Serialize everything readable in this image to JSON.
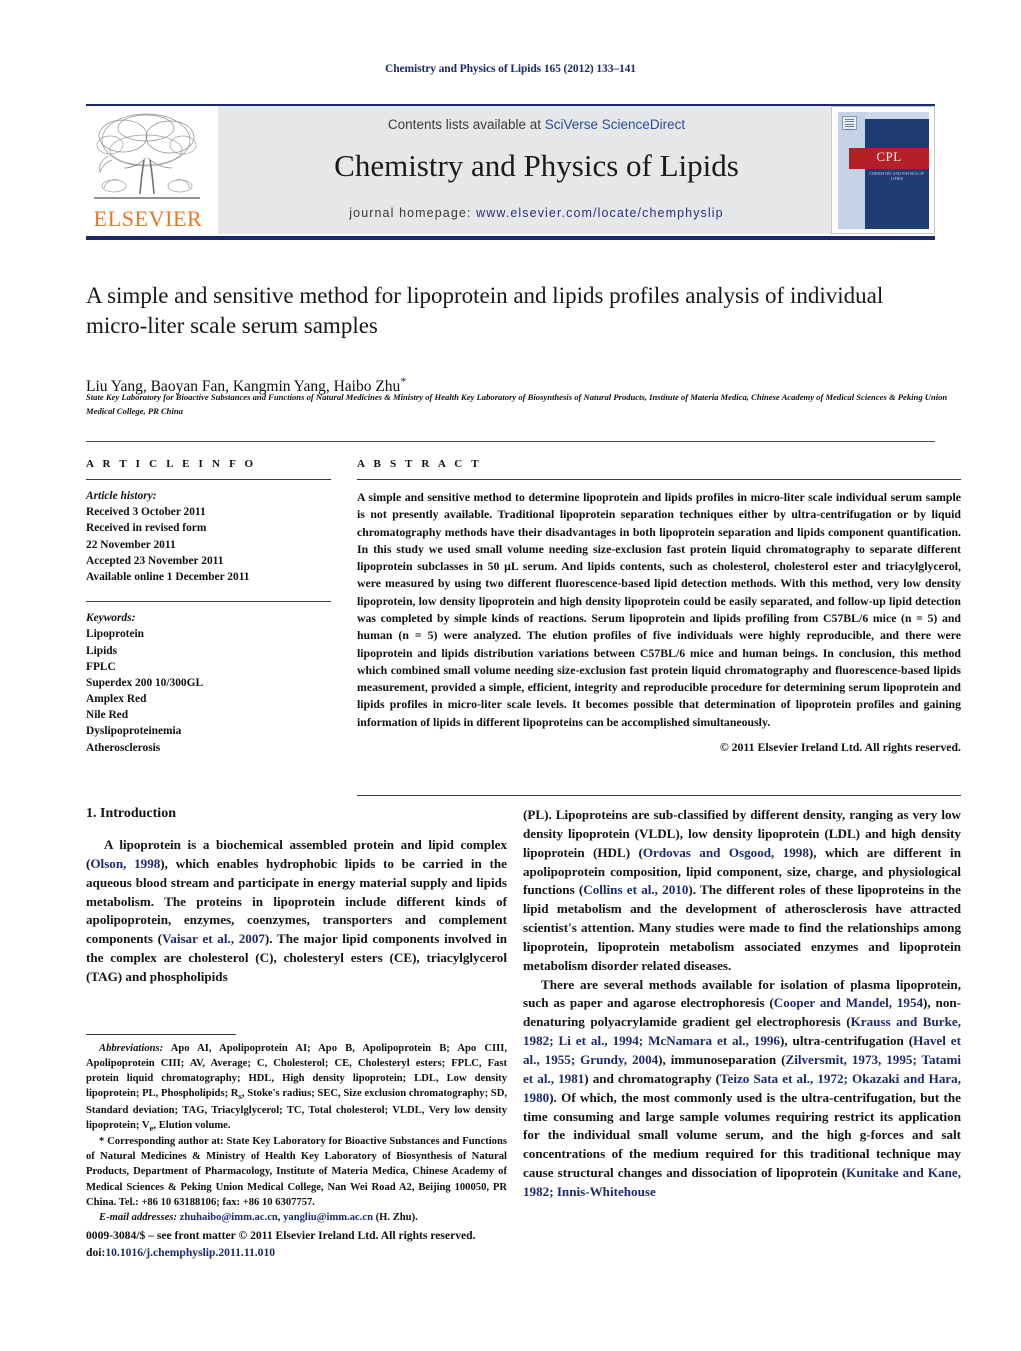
{
  "running_head": "Chemistry and Physics of Lipids 165 (2012) 133–141",
  "journal_header": {
    "contents_prefix": "Contents lists available at ",
    "contents_link": "SciVerse ScienceDirect",
    "journal_title": "Chemistry and Physics of Lipids",
    "homepage_prefix": "journal homepage: ",
    "homepage_url": "www.elsevier.com/locate/chemphyslip",
    "publisher_name": "ELSEVIER",
    "cover": {
      "badge": "CPL",
      "subtitle": "CHEMISTRY AND PHYSICS OF LIPIDS"
    }
  },
  "article": {
    "title": "A simple and sensitive method for lipoprotein and lipids profiles analysis of individual micro-liter scale serum samples",
    "authors": "Liu Yang, Baoyan Fan, Kangmin Yang, Haibo Zhu",
    "corresponding_marker": "*",
    "affiliation": "State Key Laboratory for Bioactive Substances and Functions of Natural Medicines & Ministry of Health Key Laboratory of Biosynthesis of Natural Products, Institute of Materia Medica, Chinese Academy of Medical Sciences & Peking Union Medical College, PR China"
  },
  "article_info": {
    "label": "A R T I C L E   I N F O",
    "history_label": "Article history:",
    "history": [
      "Received 3 October 2011",
      "Received in revised form",
      "22 November 2011",
      "Accepted 23 November 2011",
      "Available online 1 December 2011"
    ],
    "keywords_label": "Keywords:",
    "keywords": [
      "Lipoprotein",
      "Lipids",
      "FPLC",
      "Superdex 200 10/300GL",
      "Amplex Red",
      "Nile Red",
      "Dyslipoproteinemia",
      "Atherosclerosis"
    ]
  },
  "abstract": {
    "label": "A B S T R A C T",
    "text": "A simple and sensitive method to determine lipoprotein and lipids profiles in micro-liter scale individual serum sample is not presently available. Traditional lipoprotein separation techniques either by ultra-centrifugation or by liquid chromatography methods have their disadvantages in both lipoprotein separation and lipids component quantification. In this study we used small volume needing size-exclusion fast protein liquid chromatography to separate different lipoprotein subclasses in 50 μL serum. And lipids contents, such as cholesterol, cholesterol ester and triacylglycerol, were measured by using two different fluorescence-based lipid detection methods. With this method, very low density lipoprotein, low density lipoprotein and high density lipoprotein could be easily separated, and follow-up lipid detection was completed by simple kinds of reactions. Serum lipoprotein and lipids profiling from C57BL/6 mice (n = 5) and human (n = 5) were analyzed. The elution profiles of five individuals were highly reproducible, and there were lipoprotein and lipids distribution variations between C57BL/6 mice and human beings. In conclusion, this method which combined small volume needing size-exclusion fast protein liquid chromatography and fluorescence-based lipids measurement, provided a simple, efficient, integrity and reproducible procedure for determining serum lipoprotein and lipids profiles in micro-liter scale levels. It becomes possible that determination of lipoprotein profiles and gaining information of lipids in different lipoproteins can be accomplished simultaneously.",
    "copyright": "© 2011 Elsevier Ireland Ltd. All rights reserved."
  },
  "body": {
    "section_heading": "1. Introduction",
    "left_paragraph_1_a": "A lipoprotein is a biochemical assembled protein and lipid complex (",
    "left_ref_1": "Olson, 1998",
    "left_paragraph_1_b": "), which enables hydrophobic lipids to be carried in the aqueous blood stream and participate in energy material supply and lipids metabolism. The proteins in lipoprotein include different kinds of apolipoprotein, enzymes, coenzymes, transporters and complement components (",
    "left_ref_2": "Vaisar et al., 2007",
    "left_paragraph_1_c": "). The major lipid components involved in the complex are cholesterol (C), cholesteryl esters (CE), triacylglycerol (TAG) and phospholipids",
    "right_paragraph_1_a": "(PL). Lipoproteins are sub-classified by different density, ranging as very low density lipoprotein (VLDL), low density lipoprotein (LDL) and high density lipoprotein (HDL) (",
    "right_ref_1": "Ordovas and Osgood, 1998",
    "right_paragraph_1_b": "), which are different in apolipoprotein composition, lipid component, size, charge, and physiological functions (",
    "right_ref_2": "Collins et al., 2010",
    "right_paragraph_1_c": "). The different roles of these lipoproteins in the lipid metabolism and the development of atherosclerosis have attracted scientist's attention. Many studies were made to find the relationships among lipoprotein, lipoprotein metabolism associated enzymes and lipoprotein metabolism disorder related diseases.",
    "right_paragraph_2_a": "There are several methods available for isolation of plasma lipoprotein, such as paper and agarose electrophoresis (",
    "right_ref_3": "Cooper and Mandel, 1954",
    "right_paragraph_2_b": "), non-denaturing polyacrylamide gradient gel electrophoresis (",
    "right_ref_4": "Krauss and Burke, 1982; Li et al., 1994; McNamara et al., 1996",
    "right_paragraph_2_c": "), ultra-centrifugation (",
    "right_ref_5": "Havel et al., 1955; Grundy, 2004",
    "right_paragraph_2_d": "), immunoseparation (",
    "right_ref_6": "Zilversmit, 1973, 1995; Tatami et al., 1981",
    "right_paragraph_2_e": ") and chromatography (",
    "right_ref_7": "Teizo Sata et al., 1972; Okazaki and Hara, 1980",
    "right_paragraph_2_f": "). Of which, the most commonly used is the ultra-centrifugation, but the time consuming and large sample volumes requiring restrict its application for the individual small volume serum, and the high g-forces and salt concentrations of the medium required for this traditional technique may cause structural changes and dissociation of lipoprotein (",
    "right_ref_8": "Kunitake and Kane, 1982; Innis-Whitehouse"
  },
  "footnotes": {
    "abbreviations_label": "Abbreviations:",
    "abbreviations_text": " Apo AI, Apolipoprotein AI; Apo B, Apolipoprotein B; Apo CIII, Apolipoprotein CIII; AV, Average; C, Cholesterol; CE, Cholesteryl esters; FPLC, Fast protein liquid chromatography; HDL, High density lipoprotein; LDL, Low density lipoprotein; PL, Phospholipids; R",
    "abbreviations_sub1": "s",
    "abbreviations_text2": ", Stoke's radius; SEC, Size exclusion chromatography; SD, Standard deviation; TAG, Triacylglycerol; TC, Total cholesterol; VLDL, Very low density lipoprotein; V",
    "abbreviations_sub2": "e",
    "abbreviations_text3": ", Elution volume.",
    "corresponding_text": "* Corresponding author at: State Key Laboratory for Bioactive Substances and Functions of Natural Medicines & Ministry of Health Key Laboratory of Biosynthesis of Natural Products, Department of Pharmacology, Institute of Materia Medica, Chinese Academy of Medical Sciences & Peking Union Medical College, Nan Wei Road A2, Beijing 100050, PR China. Tel.: +86 10 63188106; fax: +86 10 6307757.",
    "email_label": "E-mail addresses:",
    "email_1": "zhuhaibo@imm.ac.cn",
    "email_2": "yangliu@imm.ac.cn",
    "email_suffix": "(H. Zhu)."
  },
  "imprint": {
    "line1": "0009-3084/$ – see front matter © 2011 Elsevier Ireland Ltd. All rights reserved.",
    "doi_prefix": "doi:",
    "doi": "10.1016/j.chemphyslip.2011.11.010"
  }
}
